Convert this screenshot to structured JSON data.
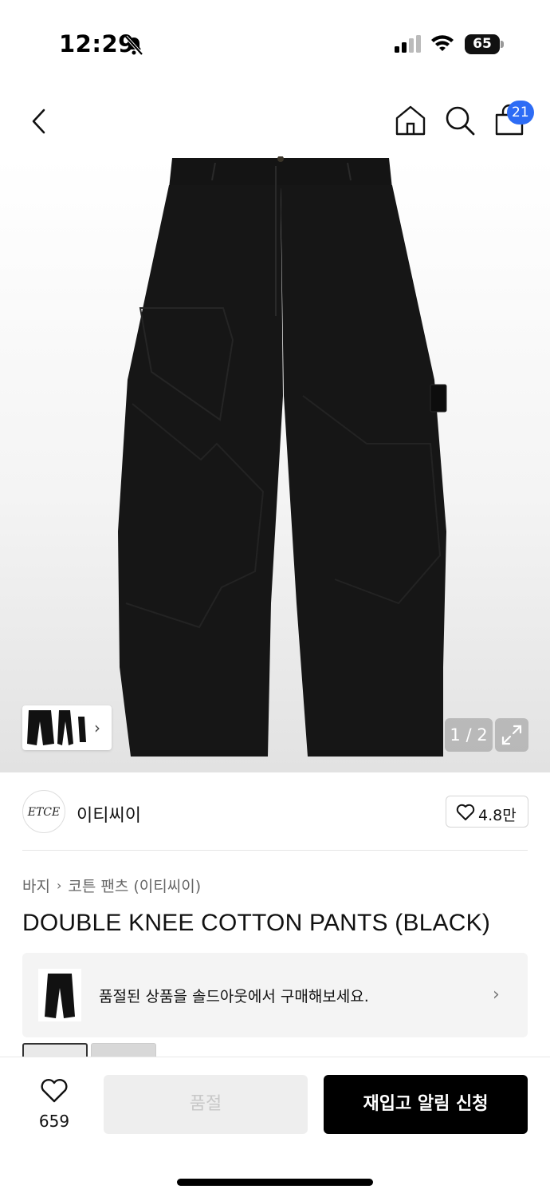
{
  "status_bar": {
    "time": "12:29",
    "battery": "65",
    "icons": [
      "bell-slash-icon",
      "cellular-signal-icon",
      "wifi-icon",
      "battery-icon"
    ]
  },
  "nav": {
    "icons": [
      "back-chevron-icon",
      "home-icon",
      "search-icon",
      "shopping-bag-icon"
    ],
    "cart_count": "21"
  },
  "gallery": {
    "page_indicator": "1 / 2",
    "thumbnail_icon": "chevron-right-icon",
    "expand_icon": "expand-icon"
  },
  "brand": {
    "logo_text": "ETCE",
    "name": "이티씨이",
    "like_count": "4.8만"
  },
  "breadcrumb": {
    "category": "바지",
    "subcategory": "코튼 팬츠 (이티씨이)"
  },
  "product": {
    "title": "DOUBLE KNEE COTTON PANTS (BLACK)"
  },
  "soldout_banner": {
    "text": "품절된 상품을 솔드아웃에서 구매해보세요."
  },
  "bottom_bar": {
    "wish_count": "659",
    "soldout_label": "품절",
    "restock_label": "재입고 알림 신청"
  },
  "colors": {
    "badge_blue": "#2d6cf5",
    "primary_black": "#000000",
    "disabled_gray": "#eeeeee"
  }
}
